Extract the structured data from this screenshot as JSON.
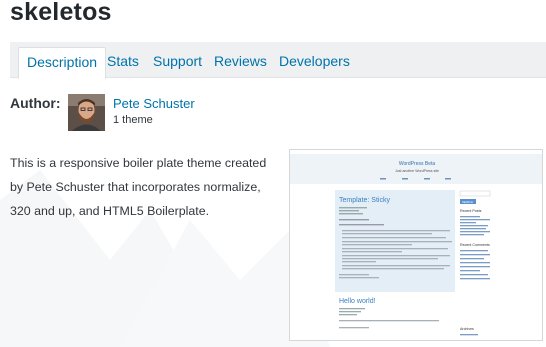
{
  "page": {
    "title": "skeletos"
  },
  "tabs": [
    {
      "label": "Description",
      "active": true
    },
    {
      "label": "Stats",
      "active": false
    },
    {
      "label": "Support",
      "active": false
    },
    {
      "label": "Reviews",
      "active": false
    },
    {
      "label": "Developers",
      "active": false
    }
  ],
  "author": {
    "label": "Author:",
    "name": "Pete Schuster",
    "theme_count": "1 theme"
  },
  "description": "This is a responsive boiler plate theme created by Pete Schuster that incorporates normalize, 320 and up, and HTML5 Boilerplate.",
  "screenshot": {
    "site_title": "WordPress Beta",
    "tagline": "Just another WordPress site",
    "post1_title": "Template: Sticky",
    "post2_title": "Hello world!",
    "search_label": "SEARCH",
    "recent_posts": "Recent Posts",
    "recent_comments": "Recent Comments",
    "archives": "Archives"
  },
  "colors": {
    "accent": "#0073aa",
    "tabbar_bg": "#eef0f2",
    "text": "#32373c"
  }
}
